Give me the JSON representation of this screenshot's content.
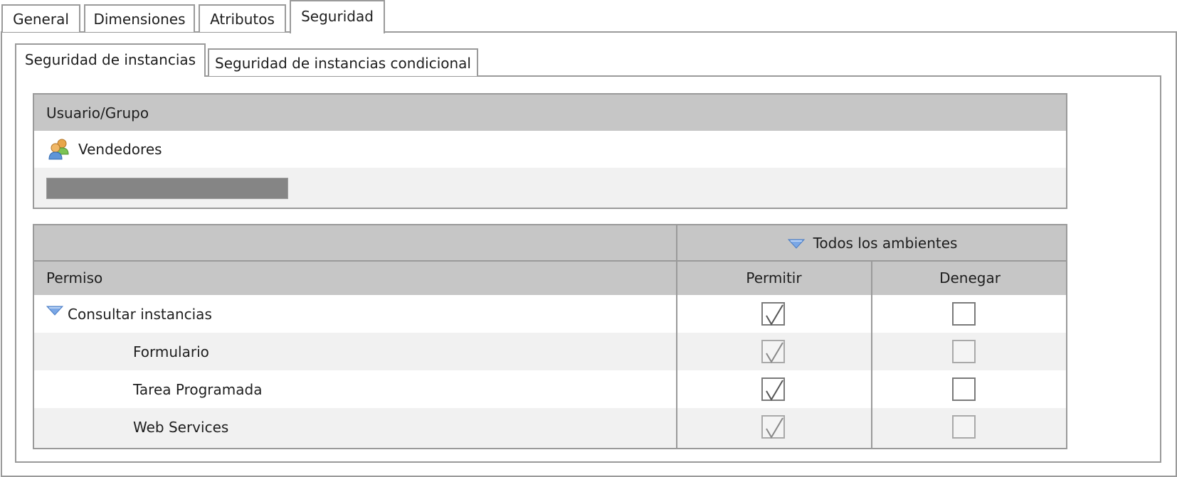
{
  "tabs": {
    "outer": [
      "General",
      "Dimensiones",
      "Atributos",
      "Seguridad"
    ],
    "inner": [
      "Seguridad de instancias",
      "Seguridad de instancias condicional"
    ]
  },
  "user_group": {
    "header": "Usuario/Grupo",
    "entries": [
      {
        "name": "Vendedores",
        "icon": "user-group-icon"
      }
    ]
  },
  "permissions": {
    "environment_header": "Todos los ambientes",
    "permission_header": "Permiso",
    "allow_header": "Permitir",
    "deny_header": "Denegar",
    "rows": [
      {
        "label": "Consultar instancias",
        "allow": true,
        "deny": false,
        "expanded": true
      },
      {
        "label": "Formulario",
        "allow": true,
        "deny": false
      },
      {
        "label": "Tarea Programada",
        "allow": true,
        "deny": false
      },
      {
        "label": "Web Services",
        "allow": true,
        "deny": false
      }
    ]
  },
  "colors": {
    "header_bg": "#c6c6c6",
    "row_alt_bg": "#f1f1f1",
    "border": "#9a9a9a",
    "expand_triangle": "#5b8fd6"
  }
}
